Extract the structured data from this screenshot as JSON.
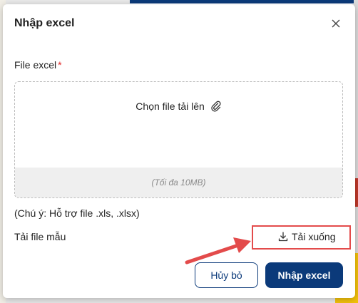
{
  "dialog": {
    "title": "Nhập excel",
    "field_label": "File excel",
    "required_mark": "*",
    "upload_prompt": "Chọn file tải lên",
    "size_limit": "(Tối đa 10MB)",
    "supported_note": "(Chú ý: Hỗ trợ file .xls, .xlsx)",
    "template_label": "Tải file mẫu",
    "download_label": "Tải xuống",
    "cancel_label": "Hủy bỏ",
    "import_label": "Nhập excel"
  },
  "colors": {
    "primary": "#0b3a7a",
    "required": "#e02424",
    "annotation": "#e34b4b"
  },
  "icons": {
    "close": "close-icon",
    "attach": "paperclip-icon",
    "download": "download-icon"
  }
}
